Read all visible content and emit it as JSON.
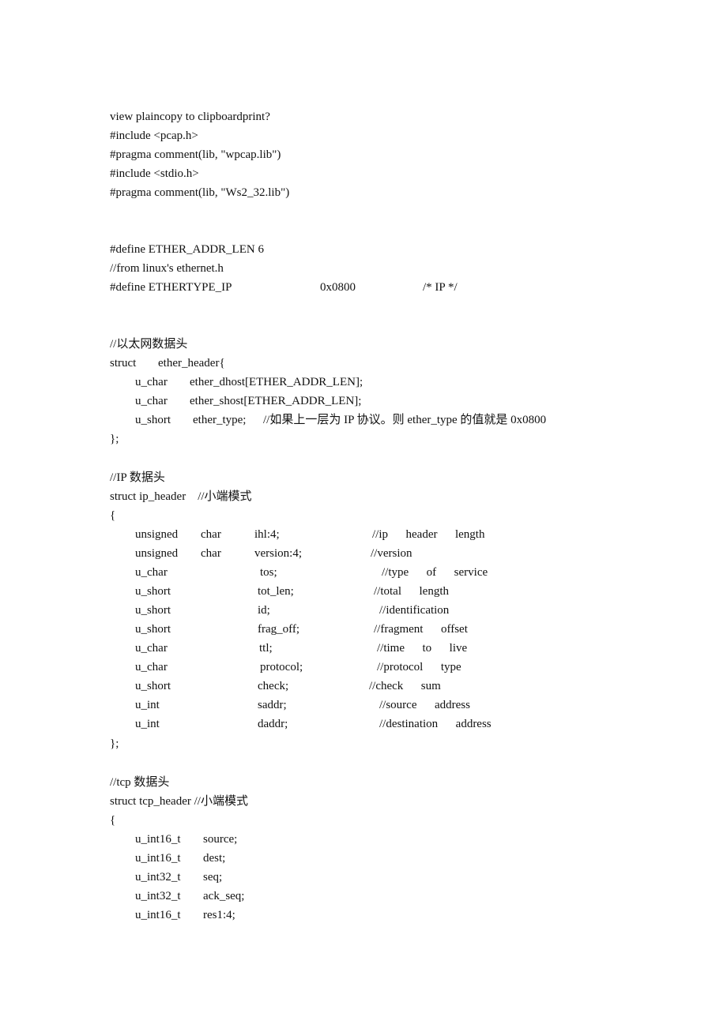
{
  "document": {
    "header_line": "view plaincopy to clipboardprint?",
    "includes": [
      "#include <pcap.h>",
      "#pragma comment(lib, \"wpcap.lib\")",
      "#include <stdio.h>",
      "#pragma comment(lib, \"Ws2_32.lib\")"
    ],
    "defines": {
      "ether_addr_len": "#define ETHER_ADDR_LEN 6",
      "from_comment": "//from linux's ethernet.h",
      "ethertype_name": "#define ETHERTYPE_IP",
      "ethertype_value": "0x0800",
      "ethertype_comment": "/* IP */"
    },
    "ether_section": {
      "comment": "//以太网数据头",
      "struct_kw": "struct",
      "struct_name": "ether_header{",
      "fields": [
        {
          "type": "u_char",
          "name": "ether_dhost[ETHER_ADDR_LEN];",
          "comment": ""
        },
        {
          "type": "u_char",
          "name": "ether_shost[ETHER_ADDR_LEN];",
          "comment": ""
        },
        {
          "type": "u_short",
          "name": "ether_type;",
          "comment": "//如果上一层为 IP 协议。则 ether_type 的值就是 0x0800"
        }
      ],
      "close": "};"
    },
    "ip_section": {
      "comment": "//IP 数据头",
      "struct_line": "struct ip_header    //小端模式",
      "open": "{",
      "fields": [
        {
          "type": "unsigned",
          "type2": "char",
          "name": "ihl:4;",
          "comment": "//ip      header      length"
        },
        {
          "type": "unsigned",
          "type2": "char",
          "name": "version:4;",
          "comment": "//version"
        },
        {
          "type": "u_char",
          "type2": "",
          "name": "tos;",
          "comment": "//type      of      service"
        },
        {
          "type": "u_short",
          "type2": "",
          "name": "tot_len;",
          "comment": "//total      length"
        },
        {
          "type": "u_short",
          "type2": "",
          "name": "id;",
          "comment": "//identification"
        },
        {
          "type": "u_short",
          "type2": "",
          "name": "frag_off;",
          "comment": "//fragment      offset"
        },
        {
          "type": "u_char",
          "type2": "",
          "name": "ttl;",
          "comment": "//time      to      live"
        },
        {
          "type": "u_char",
          "type2": "",
          "name": "protocol;",
          "comment": "//protocol      type"
        },
        {
          "type": "u_short",
          "type2": "",
          "name": "check;",
          "comment": "//check      sum"
        },
        {
          "type": "u_int",
          "type2": "",
          "name": "saddr;",
          "comment": "//source      address"
        },
        {
          "type": "u_int",
          "type2": "",
          "name": "daddr;",
          "comment": "//destination      address"
        }
      ],
      "close": "};"
    },
    "tcp_section": {
      "comment": "//tcp 数据头",
      "struct_line": "struct tcp_header //小端模式",
      "open": "{",
      "fields": [
        {
          "type": "u_int16_t",
          "name": "source;"
        },
        {
          "type": "u_int16_t",
          "name": "dest;"
        },
        {
          "type": "u_int32_t",
          "name": "seq;"
        },
        {
          "type": "u_int32_t",
          "name": "ack_seq;"
        },
        {
          "type": "u_int16_t",
          "name": "res1:4;"
        }
      ]
    }
  }
}
